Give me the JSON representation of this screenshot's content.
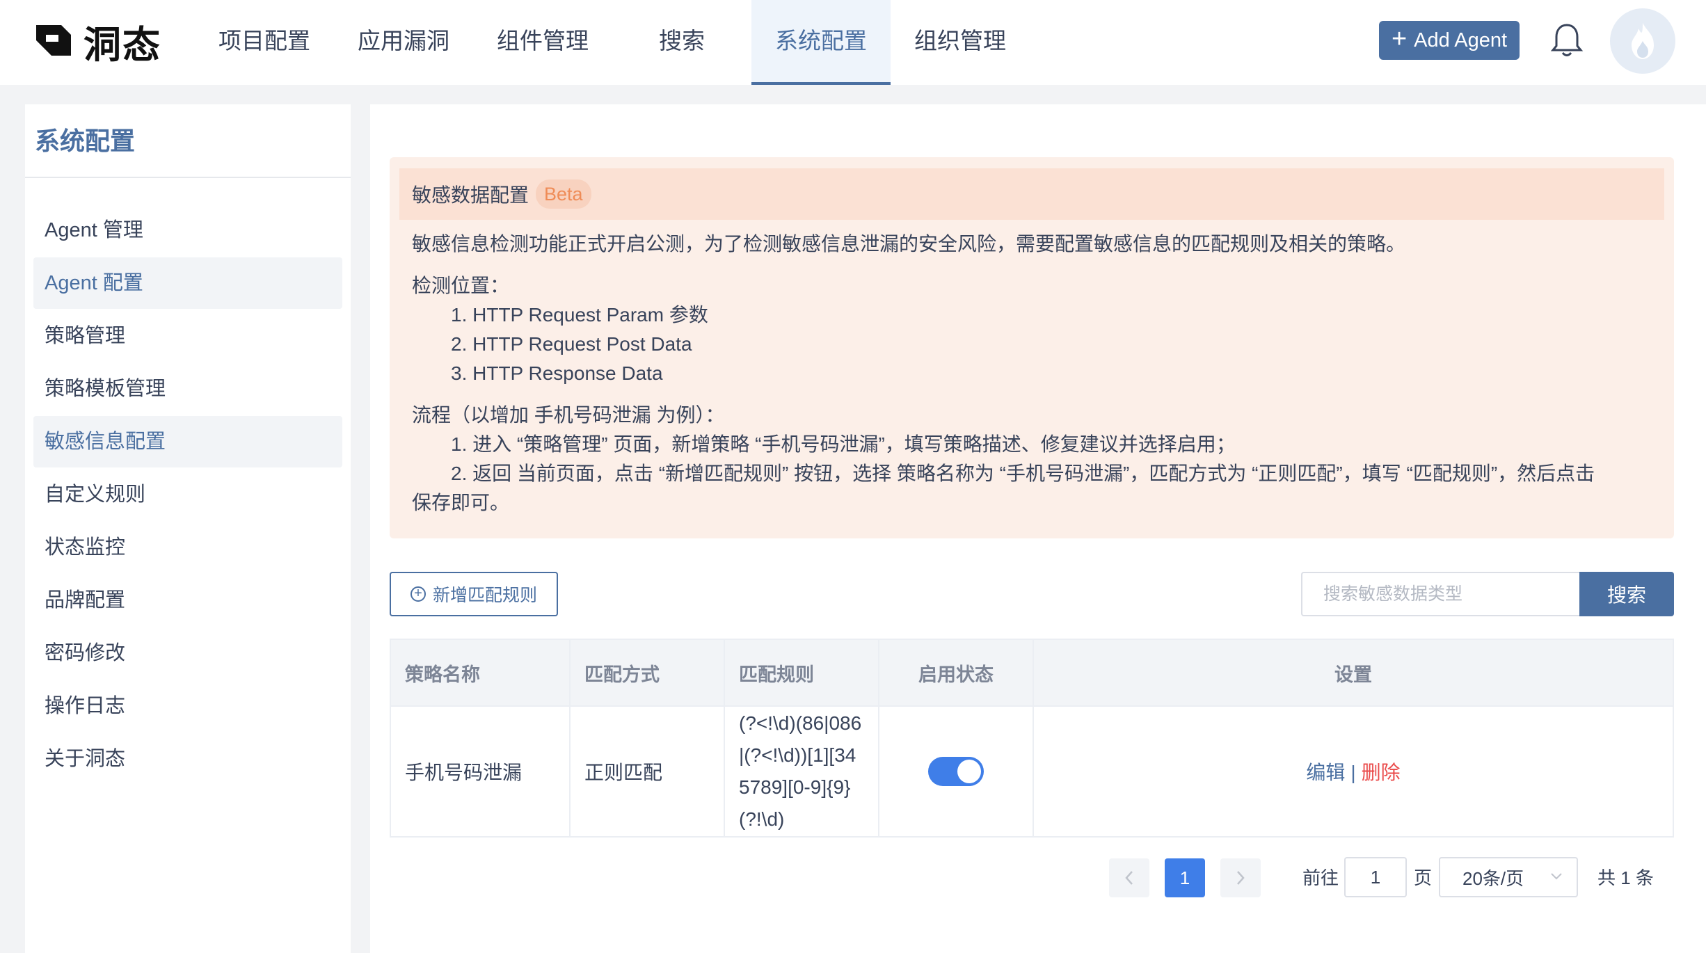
{
  "app": {
    "brand": "洞态"
  },
  "nav": {
    "items": [
      {
        "label": "项目配置"
      },
      {
        "label": "应用漏洞"
      },
      {
        "label": "组件管理"
      },
      {
        "label": "搜索"
      },
      {
        "label": "系统配置",
        "active": true
      },
      {
        "label": "组织管理"
      }
    ],
    "add_agent_label": "Add Agent"
  },
  "sidebar": {
    "title": "系统配置",
    "items": [
      {
        "label": "Agent 管理"
      },
      {
        "label": "Agent 配置",
        "active": true
      },
      {
        "label": "策略管理"
      },
      {
        "label": "策略模板管理"
      },
      {
        "label": "敏感信息配置",
        "active": true
      },
      {
        "label": "自定义规则"
      },
      {
        "label": "状态监控"
      },
      {
        "label": "品牌配置"
      },
      {
        "label": "密码修改"
      },
      {
        "label": "操作日志"
      },
      {
        "label": "关于洞态"
      }
    ]
  },
  "notice": {
    "title": "敏感数据配置",
    "badge": "Beta",
    "intro": "敏感信息检测功能正式开启公测，为了检测敏感信息泄漏的安全风险，需要配置敏感信息的匹配规则及相关的策略。",
    "location_title": "检测位置：",
    "locations": [
      "1. HTTP Request Param 参数",
      "2. HTTP Request Post Data",
      "3. HTTP Response Data"
    ],
    "flow_title": "流程（以增加 手机号码泄漏 为例）：",
    "flow_steps": [
      "1. 进入 “策略管理” 页面，新增策略 “手机号码泄漏”，填写策略描述、修复建议并选择启用；",
      "2. 返回 当前页面，点击 “新增匹配规则” 按钮，选择 策略名称为 “手机号码泄漏”，匹配方式为 “正则匹配”，填写 “匹配规则”，然后点击"
    ],
    "flow_tail": "保存即可。"
  },
  "toolbar": {
    "add_rule_label": "新增匹配规则",
    "search_placeholder": "搜索敏感数据类型",
    "search_button": "搜索"
  },
  "table": {
    "headers": [
      "策略名称",
      "匹配方式",
      "匹配规则",
      "启用状态",
      "设置"
    ],
    "rows": [
      {
        "name": "手机号码泄漏",
        "method": "正则匹配",
        "rule": "(?<!\\d)(86|086|(?<!\\d))[1][345789][0-9]{9}(?!\\d)",
        "enabled": true,
        "edit_label": "编辑",
        "separator": "|",
        "delete_label": "删除"
      }
    ]
  },
  "pagination": {
    "current_page": "1",
    "goto_label": "前往",
    "goto_value": "1",
    "page_unit": "页",
    "page_size": "20条/页",
    "total": "共 1 条"
  },
  "colors": {
    "accent": "#4a6fa1",
    "primary_blue": "#3f7ee8",
    "danger": "#ea4b4b",
    "notice_bg": "#fcefe8",
    "beta_text": "#ef8c57"
  }
}
